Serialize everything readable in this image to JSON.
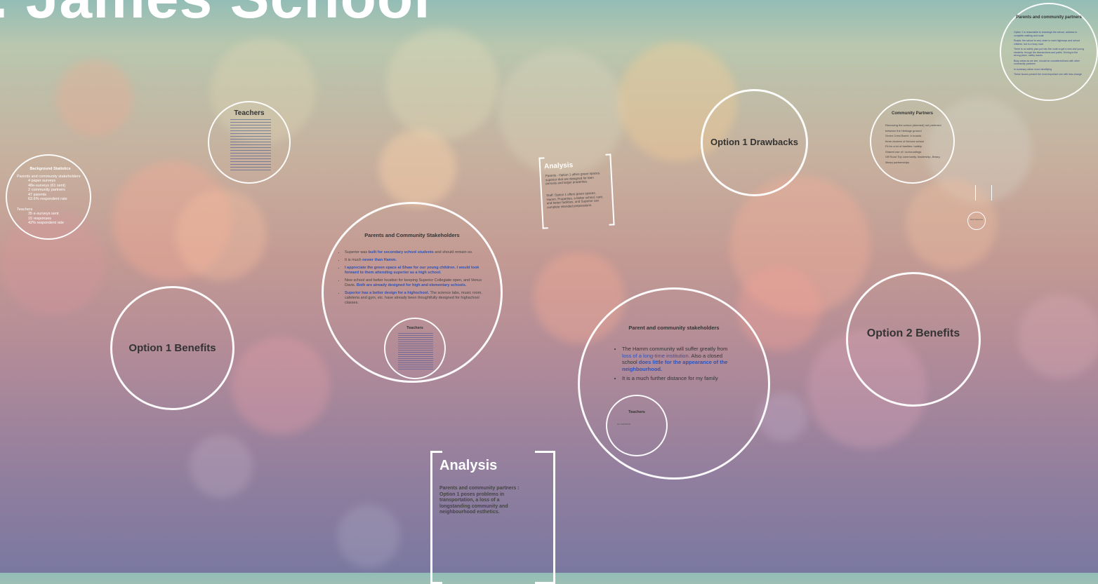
{
  "title": ". James School",
  "nodes": {
    "background_stats": {
      "heading": "Background Statistics",
      "lines": [
        "Parents and community stakeholders",
        "4 paper surveys",
        "48e-surveys (61 sent)",
        "2 community partners",
        "47 parents",
        "63.6% respondent rate",
        "Teachers",
        "35 e-surveys sent",
        "15 responses",
        "42% respondent rate"
      ]
    },
    "teachers_top": {
      "heading": "Teachers"
    },
    "option1_benefits": {
      "label": "Option 1 Benefits"
    },
    "parents_stakeholders": {
      "heading": "Parents and Community Stakeholders",
      "points": [
        {
          "pre": "Superior was ",
          "hl": "built for secondary school students",
          "post": " and should remain so."
        },
        {
          "pre": "It is much ",
          "hl": "newer than Hamm.",
          "post": ""
        },
        {
          "pre": "",
          "hl": "I appreciate the green space at Shaw for our young children. I would look forward to them attending superior as a high school.",
          "post": ""
        },
        {
          "pre": "New school and better location for keeping Superior Collegiate open, and Venus Davis. ",
          "hl": "Both are already designed for high and elementary schools.",
          "post": ""
        },
        {
          "pre": "",
          "hl": "Superior has a better design for a highschool.",
          "post": " The science labs, music room, cafeteria and gym, etc. have already been thoughtfully designed for highschool classes."
        }
      ],
      "inner_heading": "Teachers"
    },
    "analysis_small": {
      "heading": "Analysis",
      "text1": "Parents - Option 1 offers green spaces, superior that are designed for teen pursuits and larger properties.",
      "text2": "Staff: Option 1 offers green spaces, Hamm. Properties, a better school, care, and better facilities, and Superior can complete intended preparations."
    },
    "option1_drawbacks": {
      "label": "Option 1 Drawbacks"
    },
    "community_partners": {
      "heading": "Community Partners",
      "lines": [
        "Removing the school (deemed) not preferred",
        "between the Heritage ground",
        "Green Crest Barrie Jr boards",
        "three clusters of Kenora school",
        "Fit for a lot of families / safety",
        "Shared use of / surroundings",
        "Off Road Trip community, leadership, library, library partnerships"
      ]
    },
    "partners_topright": {
      "heading": "Parents and community partners",
      "lines": [
        "Option 1 is reasonable to rearrange the school, address to complete walking and route",
        "Roads: the school is very close to main highways and school children, but is a busy road",
        "There is no safety plan put into the route to get a new and young students, though the intersections and paths. Driving to the wrong place, safety issues",
        "Busy areas as we see, should be considered/used with other community partners",
        "In summary rather more identifying",
        "These issues present the most important one with less change"
      ]
    },
    "parent_stakeholders2": {
      "heading": "Parent and community stakeholders",
      "p1_pre": "The Hamm community will suffer greatly from ",
      "p1_hl": "loss of a long-time institution.",
      "p1_mid": " Also a closed school ",
      "p1_hl2": "does little for the appearance of the neighbourhood.",
      "p2": "It is a much further distance for my family",
      "inner_heading": "Teachers",
      "inner_text": "no concerns"
    },
    "option2_benefits": {
      "label": "Option 2 Benefits"
    },
    "analysis_big": {
      "heading": "Analysis",
      "text": "Parents and community partners : Option 1 poses problems in transportation, a loss of a longstanding community and neighbourhood esthetics."
    },
    "small_node": {
      "text": "Short Statement"
    }
  }
}
